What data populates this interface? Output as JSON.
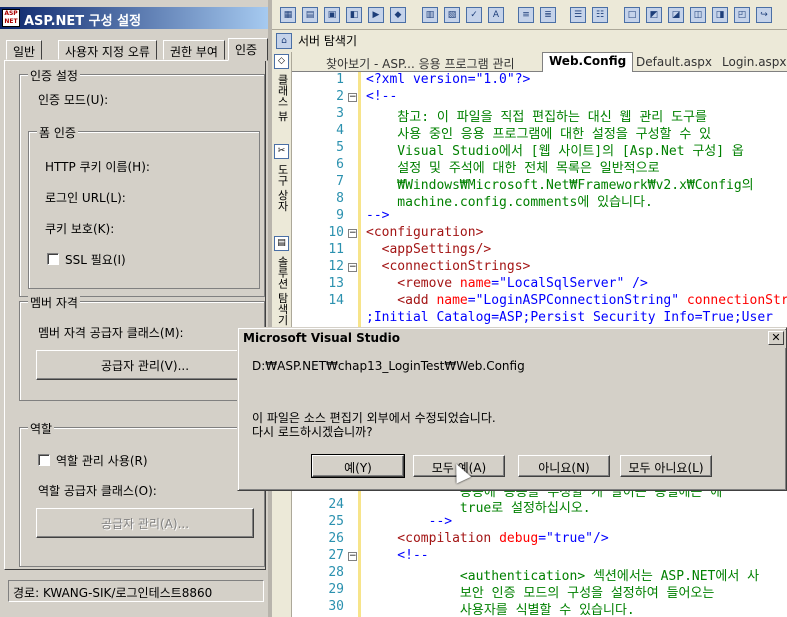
{
  "left_panel": {
    "app_title": "ASP.NET 구성 설정",
    "app_logo": "ASP NET",
    "tabs": [
      "일반",
      "사용자 지정 오류",
      "권한 부여",
      "인증"
    ],
    "auth_group": {
      "legend": "인증 설정",
      "mode_label": "인증 모드(U):",
      "form_auth_legend": "폼 인증",
      "cookie_name_label": "HTTP 쿠키 이름(H):",
      "login_url_label": "로그인 URL(L):",
      "cookie_protect_label": "쿠키 보호(K):",
      "ssl_label": "SSL 필요(I)"
    },
    "membership_group": {
      "legend": "멤버 자격",
      "provider_class_label": "멤버 자격 공급자 클래스(M):",
      "manage_button": "공급자 관리(V)..."
    },
    "roles_group": {
      "legend": "역할",
      "enable_roles_label": "역할 관리 사용(R)",
      "provider_class_label": "역할 공급자 클래스(O):",
      "manage_button": "공급자 관리(A)..."
    },
    "status_path": "경로: KWANG-SIK/로그인테스트8860"
  },
  "toolbar": {
    "explorer_label": "서버 탐색기"
  },
  "side_tabs": [
    "클래스 뷰",
    "도구 상자",
    "솔루션 탐색기"
  ],
  "doc_tabs": [
    "찾아보기 - ASP... 응용 프로그램 관리",
    "Web.Config",
    "Default.aspx",
    "Login.aspx"
  ],
  "editor": {
    "line_numbers": [
      "1",
      "2",
      "3",
      "4",
      "5",
      "6",
      "7",
      "8",
      "9",
      "10",
      "11",
      "12",
      "13",
      "14",
      "",
      "23",
      "24",
      "25",
      "26",
      "27",
      "28",
      "29",
      "30"
    ],
    "lines": {
      "l1": "<?xml version=\"1.0\"?>",
      "l2": "<!--",
      "l3": "    참고: 이 파일을 직접 편집하는 대신 웹 관리 도구를",
      "l4": "    사용 중인 응용 프로그램에 대한 설정을 구성할 수 있",
      "l5": "    Visual Studio에서 [웹 사이트]의 [Asp.Net 구성] 옵",
      "l6": "    설정 및 주석에 대한 전체 목록은 일반적으로",
      "l7": "    ₩Windows₩Microsoft.Net₩Framework₩v2.x₩Config의",
      "l8": "    machine.config.comments에 있습니다.",
      "l9": "-->",
      "l10": "<configuration>",
      "l11": "  <appSettings/>",
      "l12": "  <connectionStrings>",
      "l13_tag": "    <remove ",
      "l13_attr": "name",
      "l13_val": "\"LocalSqlServer\"",
      "l13_end": " />",
      "l14_tag": "    <add ",
      "l14_attr": "name",
      "l14_val": "\"LoginASPConnectionString\"",
      "l14_attr2": " connectionStr",
      "l14b": ";Initial Catalog=ASP;Persist Security Info=True;User",
      "l22": "            응용에 응용을 수정할 게 말이는 응얼에는 에",
      "l23": "            true로 설정하십시오.",
      "l24": "        -->",
      "l26_tag": "    <compilation ",
      "l26_attr": "debug",
      "l26_val": "\"true\"",
      "l26_end": "/>",
      "l27": "    <!--",
      "l28": "            <authentication> 섹션에서는 ASP.NET에서 사",
      "l29": "            보안 인증 모드의 구성을 설정하여 들어오는",
      "l30": "            사용자를 식별할 수 있습니다."
    }
  },
  "dialog": {
    "title": "Microsoft Visual Studio",
    "path": "D:₩ASP.NET₩chap13_LoginTest₩Web.Config",
    "message1": "이 파일은 소스 편집기 외부에서 수정되었습니다.",
    "message2": "다시 로드하시겠습니까?",
    "buttons": [
      "예(Y)",
      "모두 예(A)",
      "아니요(N)",
      "모두 아니요(L)"
    ],
    "close_glyph": "✕"
  }
}
